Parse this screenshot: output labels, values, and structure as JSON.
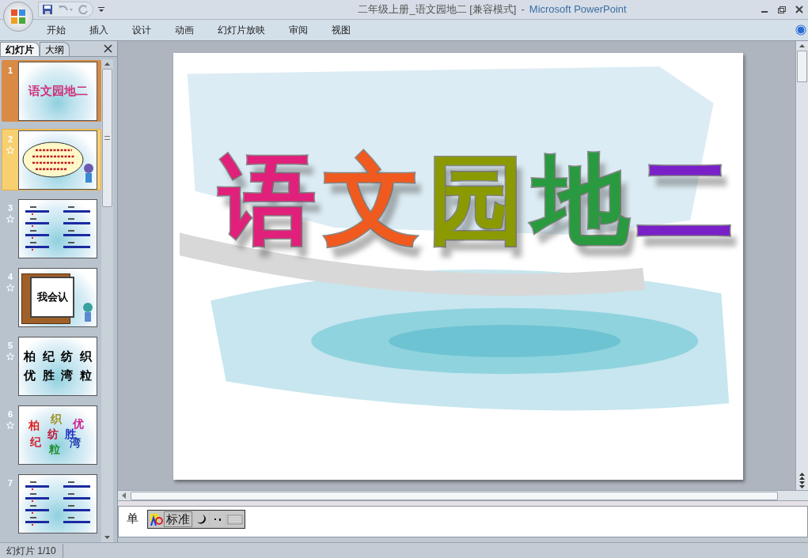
{
  "window": {
    "title": "二年级上册_语文园地二 [兼容模式]",
    "separator": "-",
    "app": "Microsoft PowerPoint"
  },
  "ribbon_tabs": [
    {
      "label": "开始",
      "selected": false
    },
    {
      "label": "插入",
      "selected": false
    },
    {
      "label": "设计",
      "selected": false
    },
    {
      "label": "动画",
      "selected": false
    },
    {
      "label": "幻灯片放映",
      "selected": false
    },
    {
      "label": "审阅",
      "selected": false
    },
    {
      "label": "视图",
      "selected": false
    }
  ],
  "panel_tabs": [
    {
      "label": "幻灯片",
      "selected": true
    },
    {
      "label": "大纲",
      "selected": false
    }
  ],
  "slides": [
    {
      "number": "1",
      "selected": true,
      "highlighted": false,
      "has_animation": false,
      "kind": "title",
      "texts": [
        "语文园地二"
      ]
    },
    {
      "number": "2",
      "selected": false,
      "highlighted": true,
      "has_animation": true,
      "kind": "bubble"
    },
    {
      "number": "3",
      "selected": false,
      "highlighted": false,
      "has_animation": true,
      "kind": "lines"
    },
    {
      "number": "4",
      "selected": false,
      "highlighted": false,
      "has_animation": true,
      "kind": "book",
      "texts": [
        "我会认"
      ]
    },
    {
      "number": "5",
      "selected": false,
      "highlighted": false,
      "has_animation": true,
      "kind": "grid",
      "texts": [
        "柏",
        "纪",
        "纺",
        "织",
        "优",
        "胜",
        "湾",
        "粒"
      ]
    },
    {
      "number": "6",
      "selected": false,
      "highlighted": false,
      "has_animation": true,
      "kind": "scatter",
      "texts": [
        "柏",
        "织",
        "优",
        "纺",
        "胜",
        "纪",
        "湾",
        "粒"
      ]
    },
    {
      "number": "7",
      "selected": false,
      "highlighted": false,
      "has_animation": false,
      "kind": "lines"
    }
  ],
  "main_slide": {
    "title_chars": [
      {
        "char": "语",
        "color": "#e0207a"
      },
      {
        "char": "文",
        "color": "#f05a1e"
      },
      {
        "char": "园",
        "color": "#8a9a00"
      },
      {
        "char": "地",
        "color": "#2a9a40"
      },
      {
        "char": "二",
        "color": "#7a20c8"
      }
    ]
  },
  "notes": {
    "text": "单"
  },
  "ime_toolbar": {
    "mode": "标准"
  },
  "status_bar": {
    "text": "幻灯片 1/10"
  }
}
